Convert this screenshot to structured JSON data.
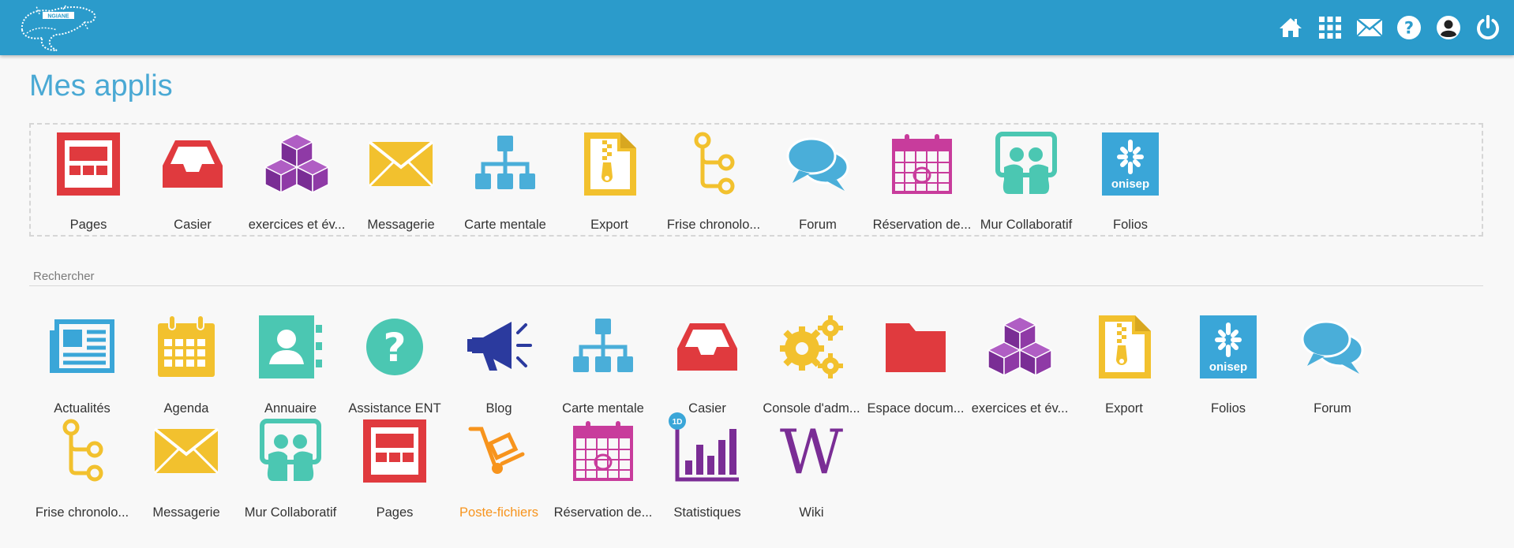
{
  "header": {
    "logo_text": "NGIANE",
    "icons": [
      "home-icon",
      "apps-grid-icon",
      "mail-icon",
      "help-icon",
      "user-icon",
      "power-icon"
    ]
  },
  "page_title": "Mes applis",
  "favorites": [
    {
      "label": "Pages",
      "icon": "pages"
    },
    {
      "label": "Casier",
      "icon": "casier"
    },
    {
      "label": "exercices et év...",
      "icon": "cubes"
    },
    {
      "label": "Messagerie",
      "icon": "messagerie"
    },
    {
      "label": "Carte mentale",
      "icon": "carte"
    },
    {
      "label": "Export",
      "icon": "export"
    },
    {
      "label": "Frise chronolo...",
      "icon": "frise"
    },
    {
      "label": "Forum",
      "icon": "forum"
    },
    {
      "label": "Réservation de...",
      "icon": "reservation"
    },
    {
      "label": "Mur Collaboratif",
      "icon": "mur"
    },
    {
      "label": "Folios",
      "icon": "folios"
    }
  ],
  "search": {
    "placeholder": "Rechercher",
    "value": ""
  },
  "apps": [
    {
      "label": "Actualités",
      "icon": "actualites"
    },
    {
      "label": "Agenda",
      "icon": "agenda"
    },
    {
      "label": "Annuaire",
      "icon": "annuaire"
    },
    {
      "label": "Assistance ENT",
      "icon": "assistance"
    },
    {
      "label": "Blog",
      "icon": "blog"
    },
    {
      "label": "Carte mentale",
      "icon": "carte"
    },
    {
      "label": "Casier",
      "icon": "casier"
    },
    {
      "label": "Console d'adm...",
      "icon": "console"
    },
    {
      "label": "Espace docum...",
      "icon": "espace"
    },
    {
      "label": "exercices et év...",
      "icon": "cubes"
    },
    {
      "label": "Export",
      "icon": "export"
    },
    {
      "label": "Folios",
      "icon": "folios"
    },
    {
      "label": "Forum",
      "icon": "forum"
    },
    {
      "label": "Frise chronolo...",
      "icon": "frise"
    },
    {
      "label": "Messagerie",
      "icon": "messagerie"
    },
    {
      "label": "Mur Collaboratif",
      "icon": "mur"
    },
    {
      "label": "Pages",
      "icon": "pages"
    },
    {
      "label": "Poste-fichiers",
      "icon": "poste",
      "highlight": true
    },
    {
      "label": "Réservation de...",
      "icon": "reservation"
    },
    {
      "label": "Statistiques",
      "icon": "statistiques",
      "badge": "1D"
    },
    {
      "label": "Wiki",
      "icon": "wiki"
    }
  ],
  "colors": {
    "header": "#2b9bcb",
    "title": "#4aa9d4",
    "highlight_label": "#f7941d"
  }
}
